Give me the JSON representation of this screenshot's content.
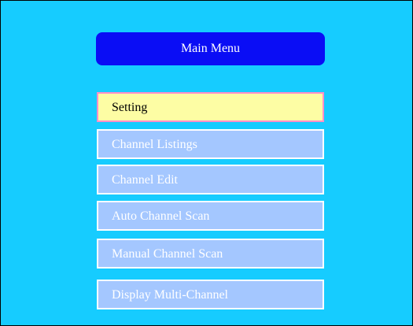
{
  "menu": {
    "title": "Main Menu",
    "selected_index": 0,
    "items": [
      {
        "label": "Setting"
      },
      {
        "label": "Channel Listings"
      },
      {
        "label": "Channel Edit"
      },
      {
        "label": "Auto Channel Scan"
      },
      {
        "label": "Manual Channel Scan"
      },
      {
        "label": "Display Multi-Channel"
      }
    ]
  },
  "colors": {
    "background": "#16ccff",
    "title_bar": "#0a0df5",
    "item_bg": "#a4c7ff",
    "item_selected_bg": "#fdfda4",
    "item_selected_border": "#ff8fc8"
  }
}
